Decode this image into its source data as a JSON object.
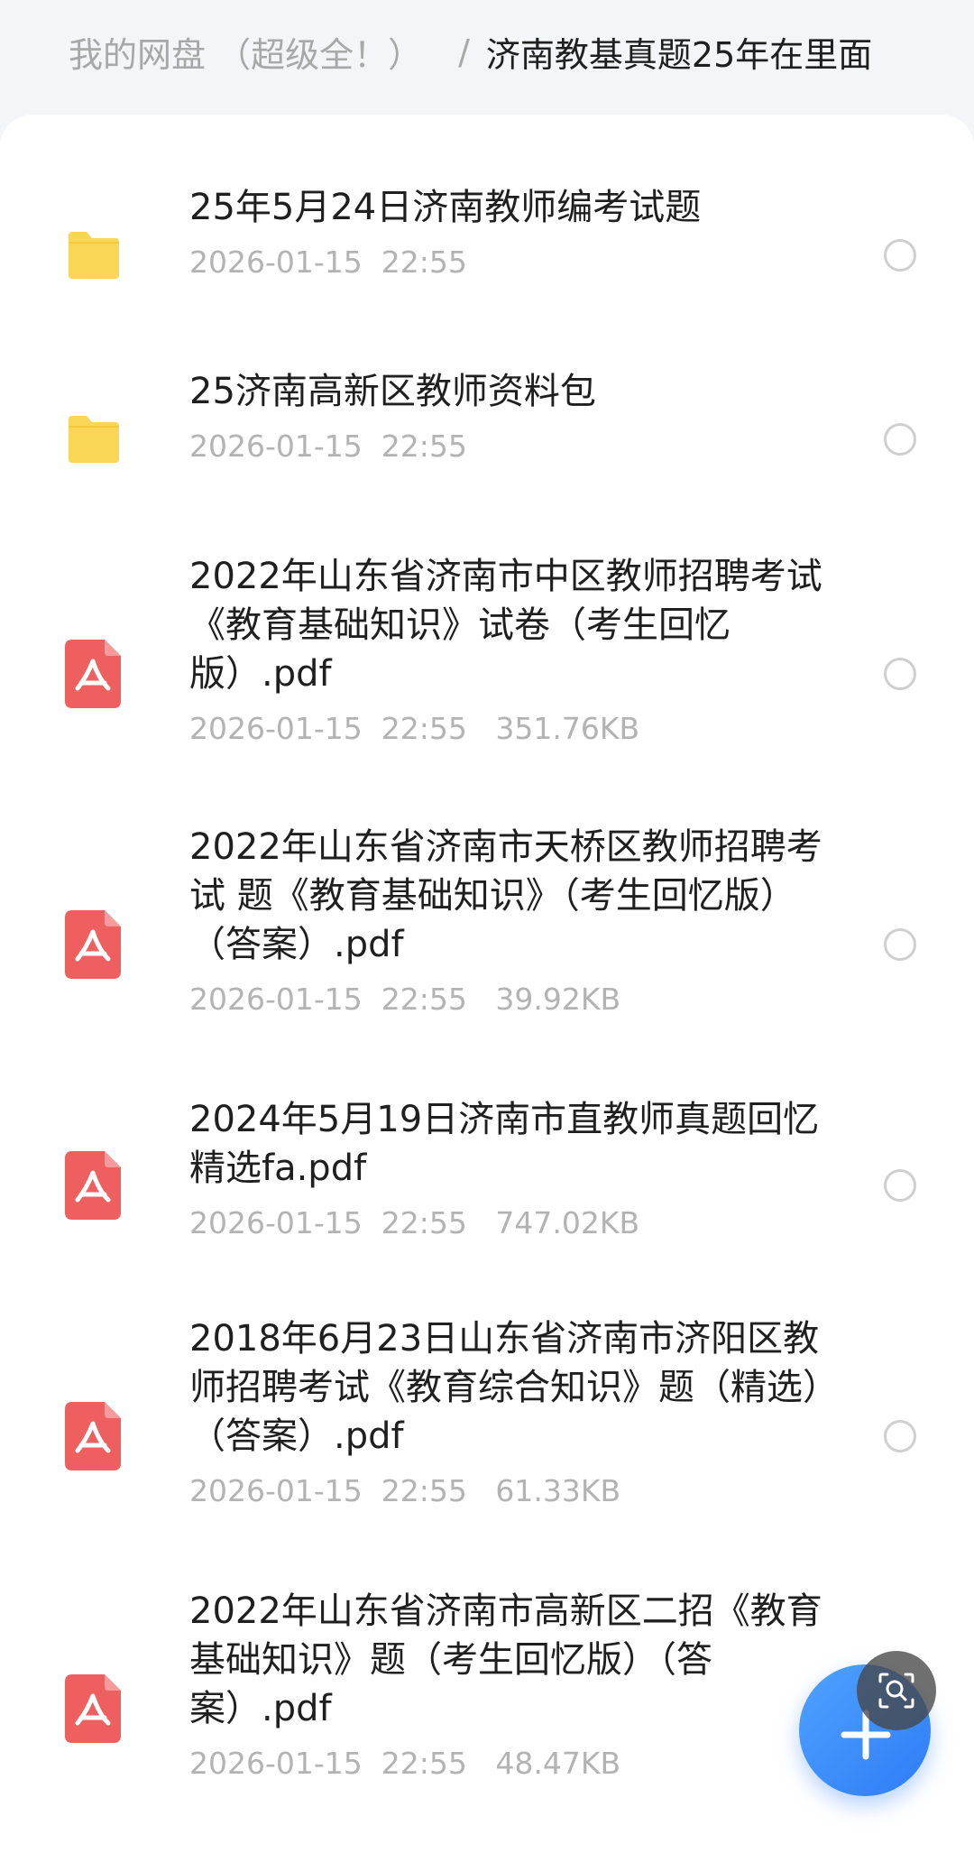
{
  "breadcrumb": {
    "root": "我的网盘 （超级全！）",
    "separator": "/",
    "current": "济南教基真题25年在里面"
  },
  "files": [
    {
      "type": "folder",
      "icon": "folder-icon",
      "name": "25年5月24日济南教师编考试题",
      "date": "2026-01-15  22:55",
      "size": ""
    },
    {
      "type": "folder",
      "icon": "folder-icon",
      "name": "25济南高新区教师资料包",
      "date": "2026-01-15  22:55",
      "size": ""
    },
    {
      "type": "pdf",
      "icon": "pdf-icon",
      "name": "2022年山东省济南市中区教师招聘考试《教育基础知识》试卷（考生回忆版）.pdf",
      "date": "2026-01-15  22:55",
      "size": "351.76KB"
    },
    {
      "type": "pdf",
      "icon": "pdf-icon",
      "name": "2022年山东省济南市天桥区教师招聘考试 题《教育基础知识》（考生回忆版）（答案）.pdf",
      "date": "2026-01-15  22:55",
      "size": "39.92KB"
    },
    {
      "type": "pdf",
      "icon": "pdf-icon",
      "name": "2024年5月19日济南市直教师真题回忆精选fa.pdf",
      "date": "2026-01-15  22:55",
      "size": "747.02KB"
    },
    {
      "type": "pdf",
      "icon": "pdf-icon",
      "name": "2018年6月23日山东省济南市济阳区教师招聘考试《教育综合知识》题（精选）（答案）.pdf",
      "date": "2026-01-15  22:55",
      "size": "61.33KB"
    },
    {
      "type": "pdf",
      "icon": "pdf-icon",
      "name": "2022年山东省济南市高新区二招《教育基础知识》题（考生回忆版）（答案）.pdf",
      "date": "2026-01-15  22:55",
      "size": "48.47KB"
    }
  ],
  "colors": {
    "folder": "#f9d656",
    "pdf": "#ee5f5f",
    "accent": "#2f7cf6"
  },
  "fab_icon": "plus-icon",
  "lens_icon": "image-search-icon"
}
